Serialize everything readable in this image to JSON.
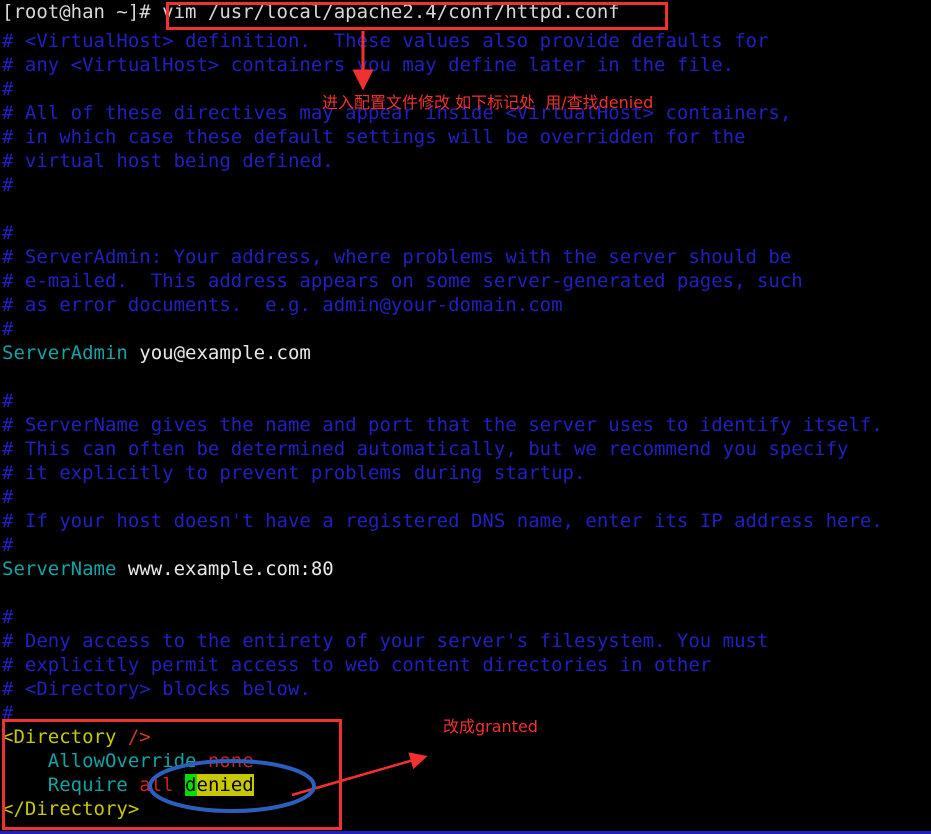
{
  "terminal": {
    "prompt": "[root@han ~]# ",
    "command": "vim /usr/local/apache2.4/conf/httpd.conf",
    "lines": [
      "# <VirtualHost> definition.  These values also provide defaults for",
      "# any <VirtualHost> containers you may define later in the file.",
      "#",
      "# All of these directives may appear inside <VirtualHost> containers,",
      "# in which case these default settings will be overridden for the",
      "# virtual host being defined.",
      "#",
      "",
      "#",
      "# ServerAdmin: Your address, where problems with the server should be",
      "# e-mailed.  This address appears on some server-generated pages, such",
      "# as error documents.  e.g. admin@your-domain.com",
      "#"
    ],
    "server_admin": {
      "directive": "ServerAdmin",
      "value": " you@example.com"
    },
    "lines2": [
      "",
      "#",
      "# ServerName gives the name and port that the server uses to identify itself.",
      "# This can often be determined automatically, but we recommend you specify",
      "# it explicitly to prevent problems during startup.",
      "#",
      "# If your host doesn't have a registered DNS name, enter its IP address here.",
      "#"
    ],
    "server_name": {
      "directive": "ServerName",
      "value": " www.example.com:80"
    },
    "lines3": [
      "",
      "#",
      "# Deny access to the entirety of your server's filesystem. You must",
      "# explicitly permit access to web content directories in other",
      "# <Directory> blocks below.",
      "#"
    ],
    "directory_block": {
      "open_tag": "<Directory ",
      "open_slash": "/>",
      "indent": "    ",
      "allow_override_key": "AllowOverride ",
      "allow_override_value": "none",
      "require_key": "Require ",
      "require_scope": "all ",
      "require_value_cursor": "d",
      "require_value_rest": "enied",
      "close_tag": "</Directory>"
    }
  },
  "annotations": {
    "command_box_label": "vim /usr/local/apache2.4/conf/httpd.conf",
    "note_top": "进入配置文件修改 如下标记处  用/查找denied",
    "note_bottom": "改成granted",
    "accent_red": "#f23030",
    "accent_blue": "#2c5fbd",
    "highlight_yellow": "#c8c800",
    "cursor_green": "#00e000"
  }
}
